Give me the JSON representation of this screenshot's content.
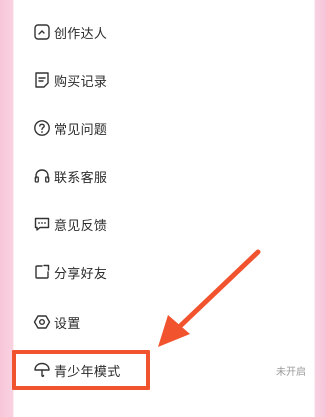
{
  "menu": {
    "items": [
      {
        "key": "creator",
        "label": "创作达人",
        "icon": "creator-icon"
      },
      {
        "key": "purchase",
        "label": "购买记录",
        "icon": "purchase-record-icon"
      },
      {
        "key": "faq",
        "label": "常见问题",
        "icon": "question-icon"
      },
      {
        "key": "support",
        "label": "联系客服",
        "icon": "headset-icon"
      },
      {
        "key": "feedback",
        "label": "意见反馈",
        "icon": "chat-bubble-icon"
      },
      {
        "key": "share",
        "label": "分享好友",
        "icon": "share-icon"
      },
      {
        "key": "settings",
        "label": "设置",
        "icon": "settings-icon"
      },
      {
        "key": "youth",
        "label": "青少年模式",
        "icon": "umbrella-icon",
        "status": "未开启"
      }
    ]
  },
  "colors": {
    "highlight": "#f2532f",
    "accent_pink": "#f7c6d9",
    "text": "#2b2b2b",
    "status": "#9a9a9a"
  }
}
